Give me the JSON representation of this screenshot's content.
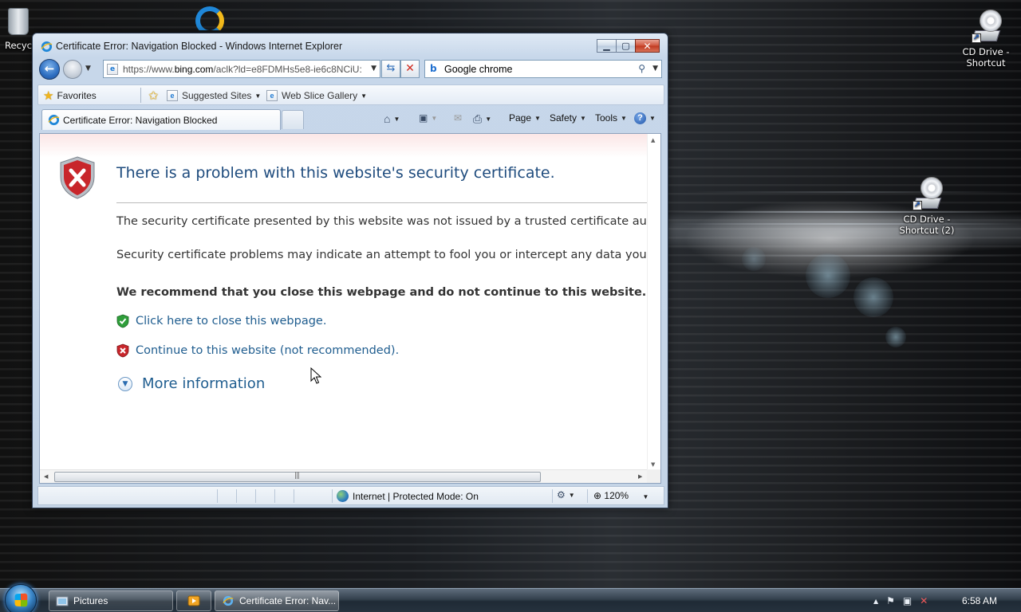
{
  "desktop": {
    "icons": [
      {
        "label": "Recyc"
      },
      {
        "label": "CD Drive - Shortcut"
      },
      {
        "label": "CD Drive - Shortcut (2)"
      }
    ]
  },
  "window": {
    "title": "Certificate Error: Navigation Blocked - Windows Internet Explorer",
    "address_prefix": "https://www.",
    "address_domain": "bing.com",
    "address_rest": "/aclk?ld=e8FDMHs5e8-ie6c8NCiU:",
    "search_value": "Google chrome",
    "favorites": {
      "favorites_label": "Favorites",
      "suggested_label": "Suggested Sites",
      "webslice_label": "Web Slice Gallery"
    },
    "tab_label": "Certificate Error: Navigation Blocked",
    "commands": {
      "page": "Page",
      "safety": "Safety",
      "tools": "Tools"
    },
    "content": {
      "heading": "There is a problem with this website's security certificate.",
      "para1": "The security certificate presented by this website was not issued by a trusted certificate authority.",
      "para2": "Security certificate problems may indicate an attempt to fool you or intercept any data you send t",
      "recommend": "We recommend that you close this webpage and do not continue to this website.",
      "close_link": "Click here to close this webpage.",
      "continue_link": "Continue to this website (not recommended).",
      "more_info": "More information"
    },
    "status": {
      "zone": "Internet | Protected Mode: On",
      "zoom": "120%"
    }
  },
  "taskbar": {
    "buttons": [
      {
        "label": "Pictures"
      },
      {
        "label": ""
      },
      {
        "label": "Certificate Error: Nav..."
      }
    ],
    "clock": "6:58 AM"
  },
  "colors": {
    "link": "#1f5d8f",
    "heading": "#1f4c7e",
    "error_red": "#c8262b",
    "safe_green": "#2f9e3a"
  }
}
